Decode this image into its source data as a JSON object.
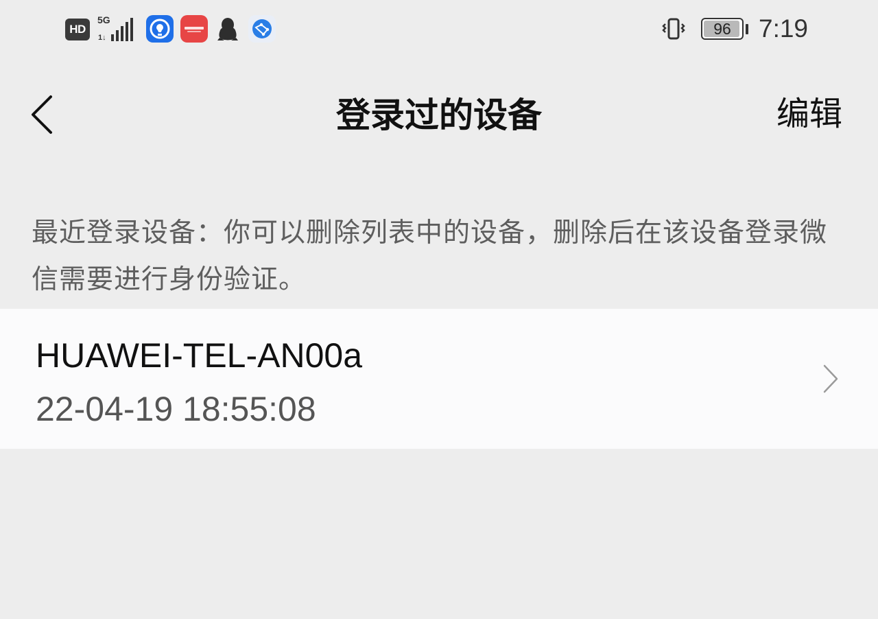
{
  "status_bar": {
    "hd_label": "HD",
    "network_label": "5G",
    "battery_level": "96",
    "battery_fraction": 0.96,
    "time": "7:19",
    "icons": [
      "hd-icon",
      "5g-signal-icon",
      "lightbulb-app-icon",
      "huawei-app-icon",
      "qq-penguin-icon",
      "browser-app-icon",
      "vibrate-icon",
      "battery-icon"
    ]
  },
  "header": {
    "back_icon": "chevron-left-icon",
    "title": "登录过的设备",
    "edit_label": "编辑"
  },
  "description": {
    "text": "最近登录设备：你可以删除列表中的设备，删除后在该设备登录微信需要进行身份验证。"
  },
  "devices": [
    {
      "name": "HUAWEI-TEL-AN00a",
      "last_login": "22-04-19 18:55:08",
      "icon": "chevron-right-icon"
    }
  ],
  "colors": {
    "background": "#ededed",
    "list_background": "#fbfbfc",
    "text_primary": "#111111",
    "text_secondary": "#5e5e5e"
  }
}
